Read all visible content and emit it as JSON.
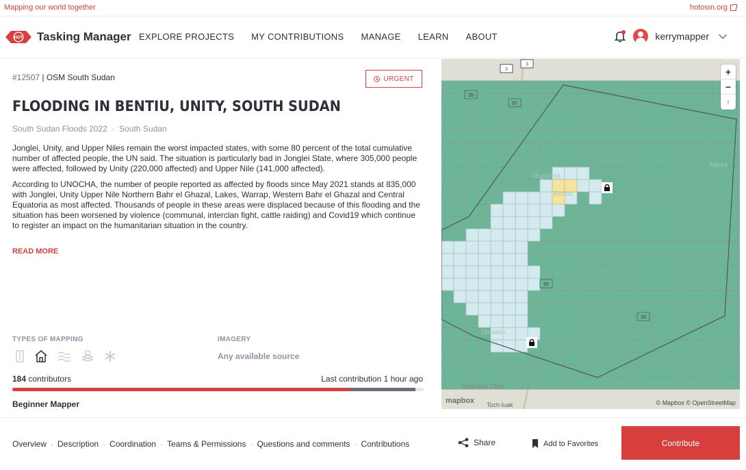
{
  "topbar": {
    "tagline": "Mapping our world together",
    "hot_link": "hotosm.org"
  },
  "header": {
    "logo_text": "Tasking Manager",
    "nav": [
      "EXPLORE PROJECTS",
      "MY CONTRIBUTIONS",
      "MANAGE",
      "LEARN",
      "ABOUT"
    ],
    "username": "kerrymapper"
  },
  "project": {
    "id": "#12507",
    "org": "OSM South Sudan",
    "priority": "URGENT",
    "title": "FLOODING IN BENTIU, UNITY, SOUTH SUDAN",
    "campaign": "South Sudan Floods 2022",
    "country": "South Sudan",
    "description": [
      "Jonglei, Unity, and Upper Niles remain the worst impacted states, with some 80 percent of the total cumulative number of affected people, the UN said. The situation is particularly bad in Jonglei State, where 305,000 people were affected, followed by Unity (220,000 affected) and Upper Nile (141,000 affected).",
      "According to UNOCHA, the number of people reported as affected by floods since May 2021 stands at 835,000 with Jonglei, Unity Upper Nile Northern Bahr el Ghazal, Lakes, Warrap, Western Bahr el Ghazal and Central Equatoria as most affected. Thousands of people in these areas were displaced because of this flooding and the situation has been worsened by violence (communal, interclan fight, cattle raiding) and Covid19 which continue to register an impact on the humanitarian situation in the country."
    ],
    "read_more": "READ MORE",
    "types_of_mapping_label": "TYPES OF MAPPING",
    "mapping_icons": [
      "roads-icon",
      "buildings-icon",
      "waterways-icon",
      "land-use-icon",
      "other-icon"
    ],
    "imagery_label": "IMAGERY",
    "imagery_value": "Any available source",
    "contributors_count": "184",
    "contributors_label": "contributors",
    "last_contribution": "Last contribution 1 hour ago",
    "progress_mapped_fraction": 0.82,
    "progress_validated_fraction": 0.16,
    "difficulty": "Beginner Mapper"
  },
  "map": {
    "attribution": "© Mapbox © OpenStreetMap",
    "brand": "mapbox",
    "places": [
      "Nimni",
      "Rupkona",
      "Bentiu",
      "Nhialdiu",
      "Toch-luak Chan",
      "Toch-luak"
    ],
    "road_labels": [
      "3",
      "3",
      "35",
      "57",
      "55",
      "33"
    ],
    "zoom_in": "+",
    "zoom_out": "−",
    "compass": "↑"
  },
  "footer": {
    "tabs": [
      "Overview",
      "Description",
      "Coordination",
      "Teams & Permissions",
      "Questions and comments",
      "Contributions"
    ],
    "share": "Share",
    "favorites": "Add to Favorites",
    "contribute": "Contribute"
  },
  "colors": {
    "accent": "#d73f3f",
    "progress_mapped": "#d73f3f",
    "progress_validated": "#68707f",
    "map_grid_unmapped": "#6db597",
    "map_grid_mapped": "#d3eaee",
    "map_grid_locked": "#f5e3a0"
  }
}
